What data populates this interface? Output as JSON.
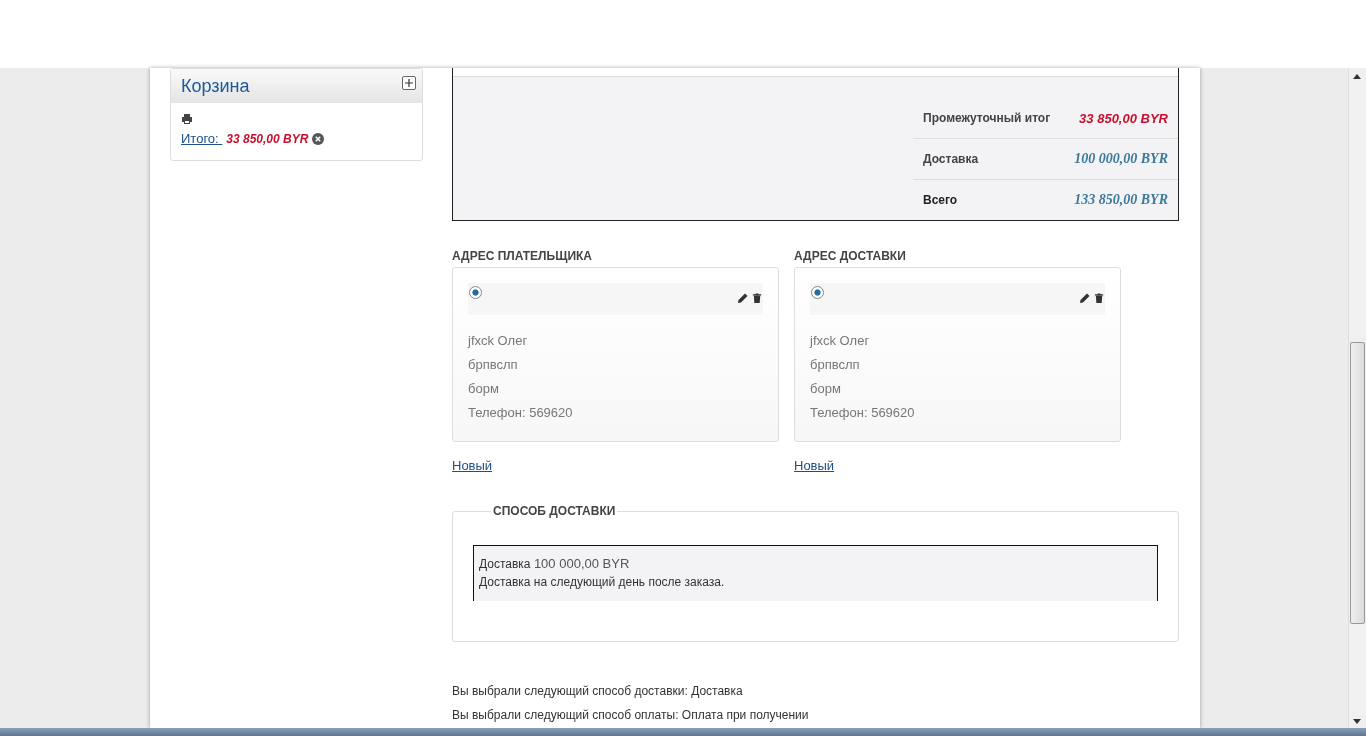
{
  "cart": {
    "title": "Корзина",
    "total_label": "Итого: ",
    "total_value": "33 850,00 BYR"
  },
  "totals": [
    {
      "label": "Промежуточный итог",
      "value": "33 850,00 BYR",
      "kind": "subtotal"
    },
    {
      "label": "Доставка",
      "value": "100 000,00 BYR",
      "kind": "plain"
    },
    {
      "label": "Всего",
      "value": "133 850,00 BYR",
      "kind": "plain"
    }
  ],
  "addresses": [
    {
      "heading": "АДРЕС ПЛАТЕЛЬЩИКА",
      "selected": true,
      "lines": [
        "jfxck Олег",
        "брпвслп",
        "борм",
        "Телефон: 569620"
      ],
      "new_link": "Новый"
    },
    {
      "heading": "АДРЕС ДОСТАВКИ",
      "selected": true,
      "lines": [
        "jfxck Олег",
        "брпвслп",
        "борм",
        "Телефон: 569620"
      ],
      "new_link": "Новый"
    }
  ],
  "shipping": {
    "legend": "СПОСОБ ДОСТАВКИ",
    "option_title": "Доставка",
    "option_price": "100 000,00 BYR",
    "option_description": "Доставка на следующий день после заказа."
  },
  "summary": [
    "Вы выбрали следующий способ доставки: Доставка",
    "Вы выбрали следующий способ оплаты: Оплата при получении"
  ]
}
